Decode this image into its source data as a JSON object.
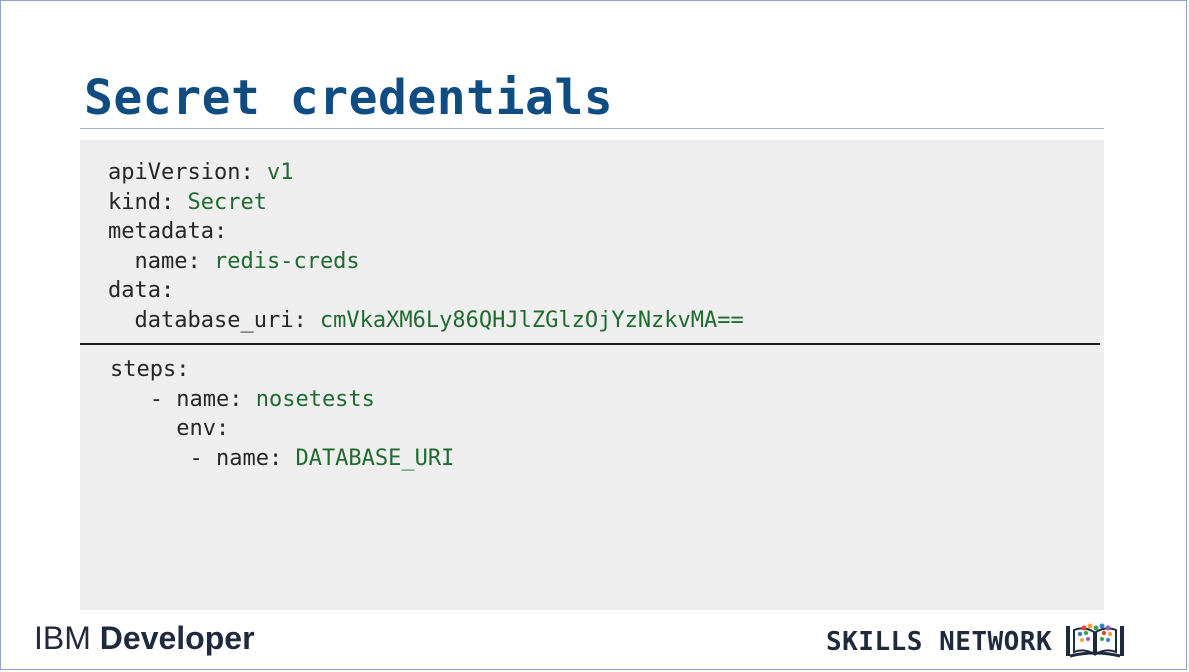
{
  "slide": {
    "title": "Secret credentials"
  },
  "yaml_secret": {
    "lines": [
      {
        "indent": "",
        "key": "apiVersion:",
        "value": " v1"
      },
      {
        "indent": "",
        "key": "kind:",
        "value": " Secret"
      },
      {
        "indent": "",
        "key": "metadata:",
        "value": ""
      },
      {
        "indent": "  ",
        "key": "name:",
        "value": " redis-creds"
      },
      {
        "indent": "",
        "key": "data:",
        "value": ""
      },
      {
        "indent": "  ",
        "key": "database_uri:",
        "value": " cmVkaXM6Ly86QHJlZGlzOjYzNzkvMA=="
      }
    ]
  },
  "yaml_steps": {
    "lines": [
      {
        "indent": "",
        "key": "steps:",
        "value": ""
      },
      {
        "indent": "   ",
        "key": "- name:",
        "value": " nosetests"
      },
      {
        "indent": "     ",
        "key": "env:",
        "value": ""
      },
      {
        "indent": "      ",
        "key": "- name:",
        "value": " DATABASE_URI"
      }
    ]
  },
  "footer": {
    "ibm_part1": "IBM ",
    "ibm_part2": "Developer",
    "skills_network": "SKILLS NETWORK",
    "skills_icon": "book-icon"
  },
  "colors": {
    "title": "#0f4c81",
    "code_key": "#262626",
    "code_value": "#1f6b2f",
    "panel_bg": "#eeeeee"
  }
}
